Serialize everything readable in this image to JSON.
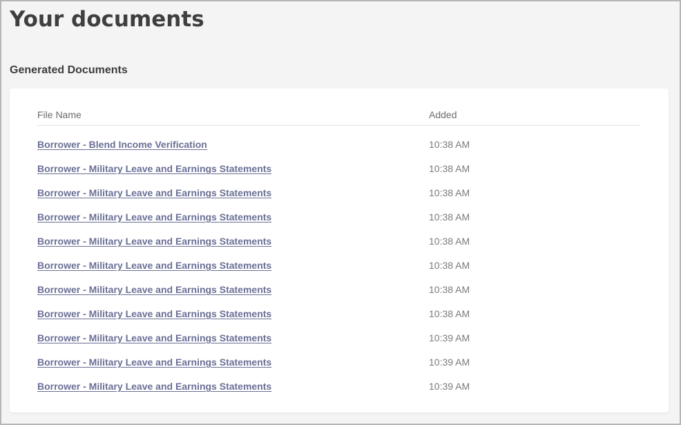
{
  "page": {
    "title": "Your documents"
  },
  "generated": {
    "section_title": "Generated Documents",
    "columns": {
      "file_name": "File Name",
      "added": "Added"
    },
    "rows": [
      {
        "name": "Borrower - Blend Income Verification",
        "added": "10:38 AM"
      },
      {
        "name": "Borrower - Military Leave and Earnings Statements",
        "added": "10:38 AM"
      },
      {
        "name": "Borrower - Military Leave and Earnings Statements",
        "added": "10:38 AM"
      },
      {
        "name": "Borrower - Military Leave and Earnings Statements",
        "added": "10:38 AM"
      },
      {
        "name": "Borrower - Military Leave and Earnings Statements",
        "added": "10:38 AM"
      },
      {
        "name": "Borrower - Military Leave and Earnings Statements",
        "added": "10:38 AM"
      },
      {
        "name": "Borrower - Military Leave and Earnings Statements",
        "added": "10:38 AM"
      },
      {
        "name": "Borrower - Military Leave and Earnings Statements",
        "added": "10:38 AM"
      },
      {
        "name": "Borrower - Military Leave and Earnings Statements",
        "added": "10:39 AM"
      },
      {
        "name": "Borrower - Military Leave and Earnings Statements",
        "added": "10:39 AM"
      },
      {
        "name": "Borrower - Military Leave and Earnings Statements",
        "added": "10:39 AM"
      }
    ]
  },
  "colors": {
    "link": "#6a6f95",
    "title": "#3f3f3f",
    "background": "#f4f4f4",
    "card": "#ffffff"
  }
}
